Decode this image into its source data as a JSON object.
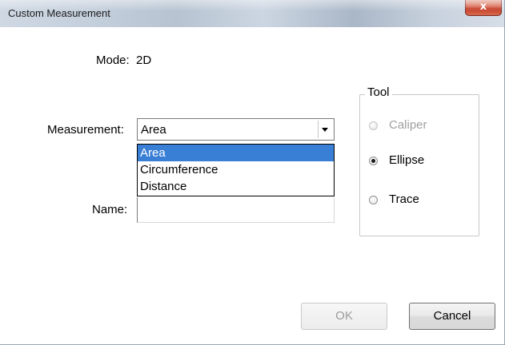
{
  "window": {
    "title": "Custom Measurement",
    "close_label": "x"
  },
  "mode": {
    "label": "Mode:",
    "value": "2D"
  },
  "measurement": {
    "label": "Measurement:",
    "selected": "Area",
    "options": [
      "Area",
      "Circumference",
      "Distance"
    ]
  },
  "name": {
    "label": "Name:",
    "value": ""
  },
  "tool": {
    "legend": "Tool",
    "options": [
      {
        "label": "Caliper",
        "checked": false,
        "disabled": true
      },
      {
        "label": "Ellipse",
        "checked": true,
        "disabled": false
      },
      {
        "label": "Trace",
        "checked": false,
        "disabled": false
      }
    ]
  },
  "buttons": {
    "ok_label": "OK",
    "ok_enabled": false,
    "cancel_label": "Cancel"
  },
  "colors": {
    "selection": "#3a7fd6",
    "disabled_text": "#a0a0a0",
    "close_button": "#c9432b"
  }
}
